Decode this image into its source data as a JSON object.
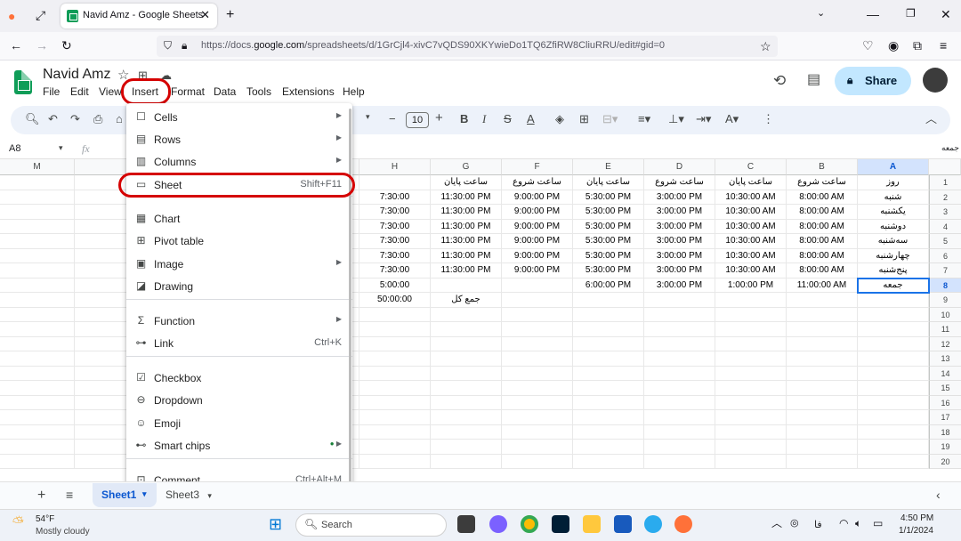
{
  "browser": {
    "tab_title": "Navid Amz - Google Sheets",
    "url_prefix": "https://docs.",
    "url_domain": "google.com",
    "url_path": "/spreadsheets/d/1GrCjl4-xivC7vQDS90XKYwieDo1TQ6ZfiRW8CliuRRU/edit#gid=0"
  },
  "doc": {
    "title": "Navid Amz",
    "menus": [
      "File",
      "Edit",
      "View",
      "Insert",
      "Format",
      "Data",
      "Tools",
      "Extensions",
      "Help"
    ],
    "share_label": "Share"
  },
  "toolbar": {
    "font_size": "10"
  },
  "formula": {
    "name_box": "A8",
    "fx": "fx",
    "right_text": "جمعه"
  },
  "grid": {
    "columns": [
      "M",
      "L",
      "H",
      "G",
      "F",
      "E",
      "D",
      "C",
      "B",
      "A"
    ],
    "rows": [
      "1",
      "2",
      "3",
      "4",
      "5",
      "6",
      "7",
      "8",
      "9",
      "10",
      "11",
      "12",
      "13",
      "14",
      "15",
      "16",
      "17",
      "18",
      "19",
      "20"
    ],
    "cells": [
      [
        "",
        "",
        "",
        "ساعت پایان",
        "ساعت شروع",
        "ساعت پایان",
        "ساعت شروع",
        "ساعت پایان",
        "ساعت شروع",
        "روز"
      ],
      [
        "",
        "",
        "7:30:00",
        "11:30:00 PM",
        "9:00:00 PM",
        "5:30:00 PM",
        "3:00:00 PM",
        "10:30:00 AM",
        "8:00:00 AM",
        "شنبه"
      ],
      [
        "",
        "",
        "7:30:00",
        "11:30:00 PM",
        "9:00:00 PM",
        "5:30:00 PM",
        "3:00:00 PM",
        "10:30:00 AM",
        "8:00:00 AM",
        "یکشنبه"
      ],
      [
        "",
        "",
        "7:30:00",
        "11:30:00 PM",
        "9:00:00 PM",
        "5:30:00 PM",
        "3:00:00 PM",
        "10:30:00 AM",
        "8:00:00 AM",
        "دوشنبه"
      ],
      [
        "",
        "",
        "7:30:00",
        "11:30:00 PM",
        "9:00:00 PM",
        "5:30:00 PM",
        "3:00:00 PM",
        "10:30:00 AM",
        "8:00:00 AM",
        "سه‌شنبه"
      ],
      [
        "",
        "",
        "7:30:00",
        "11:30:00 PM",
        "9:00:00 PM",
        "5:30:00 PM",
        "3:00:00 PM",
        "10:30:00 AM",
        "8:00:00 AM",
        "چهارشنبه"
      ],
      [
        "",
        "",
        "7:30:00",
        "11:30:00 PM",
        "9:00:00 PM",
        "5:30:00 PM",
        "3:00:00 PM",
        "10:30:00 AM",
        "8:00:00 AM",
        "پنج‌شنبه"
      ],
      [
        "",
        "",
        "5:00:00",
        "",
        "",
        "6:00:00 PM",
        "3:00:00 PM",
        "1:00:00 PM",
        "11:00:00 AM",
        "جمعه"
      ],
      [
        "",
        "",
        "50:00:00",
        "جمع کل",
        "",
        "",
        "",
        "",
        "",
        ""
      ]
    ]
  },
  "insert_menu": {
    "items": [
      {
        "label": "Cells",
        "icon": "checkbox-empty-icon",
        "submenu": true
      },
      {
        "label": "Rows",
        "icon": "rows-icon",
        "submenu": true
      },
      {
        "label": "Columns",
        "icon": "columns-icon",
        "submenu": true
      },
      {
        "label": "Sheet",
        "icon": "sheet-icon",
        "shortcut": "Shift+F11"
      },
      {
        "label": "Chart",
        "icon": "chart-icon"
      },
      {
        "label": "Pivot table",
        "icon": "pivot-table-icon"
      },
      {
        "label": "Image",
        "icon": "image-icon",
        "submenu": true
      },
      {
        "label": "Drawing",
        "icon": "drawing-icon"
      },
      {
        "label": "Function",
        "icon": "sigma-icon",
        "submenu": true
      },
      {
        "label": "Link",
        "icon": "link-icon",
        "shortcut": "Ctrl+K"
      },
      {
        "label": "Checkbox",
        "icon": "checkbox-icon"
      },
      {
        "label": "Dropdown",
        "icon": "dropdown-icon"
      },
      {
        "label": "Emoji",
        "icon": "emoji-icon"
      },
      {
        "label": "Smart chips",
        "icon": "smart-chips-icon",
        "submenu": true
      },
      {
        "label": "Comment",
        "icon": "comment-icon",
        "shortcut": "Ctrl+Alt+M"
      }
    ]
  },
  "sheets": {
    "tabs": [
      "Sheet1",
      "Sheet3"
    ]
  },
  "taskbar": {
    "weather_temp": "54°F",
    "weather_desc": "Mostly cloudy",
    "search_placeholder": "Search",
    "lang": "فا",
    "time": "4:50 PM",
    "date": "1/1/2024"
  }
}
